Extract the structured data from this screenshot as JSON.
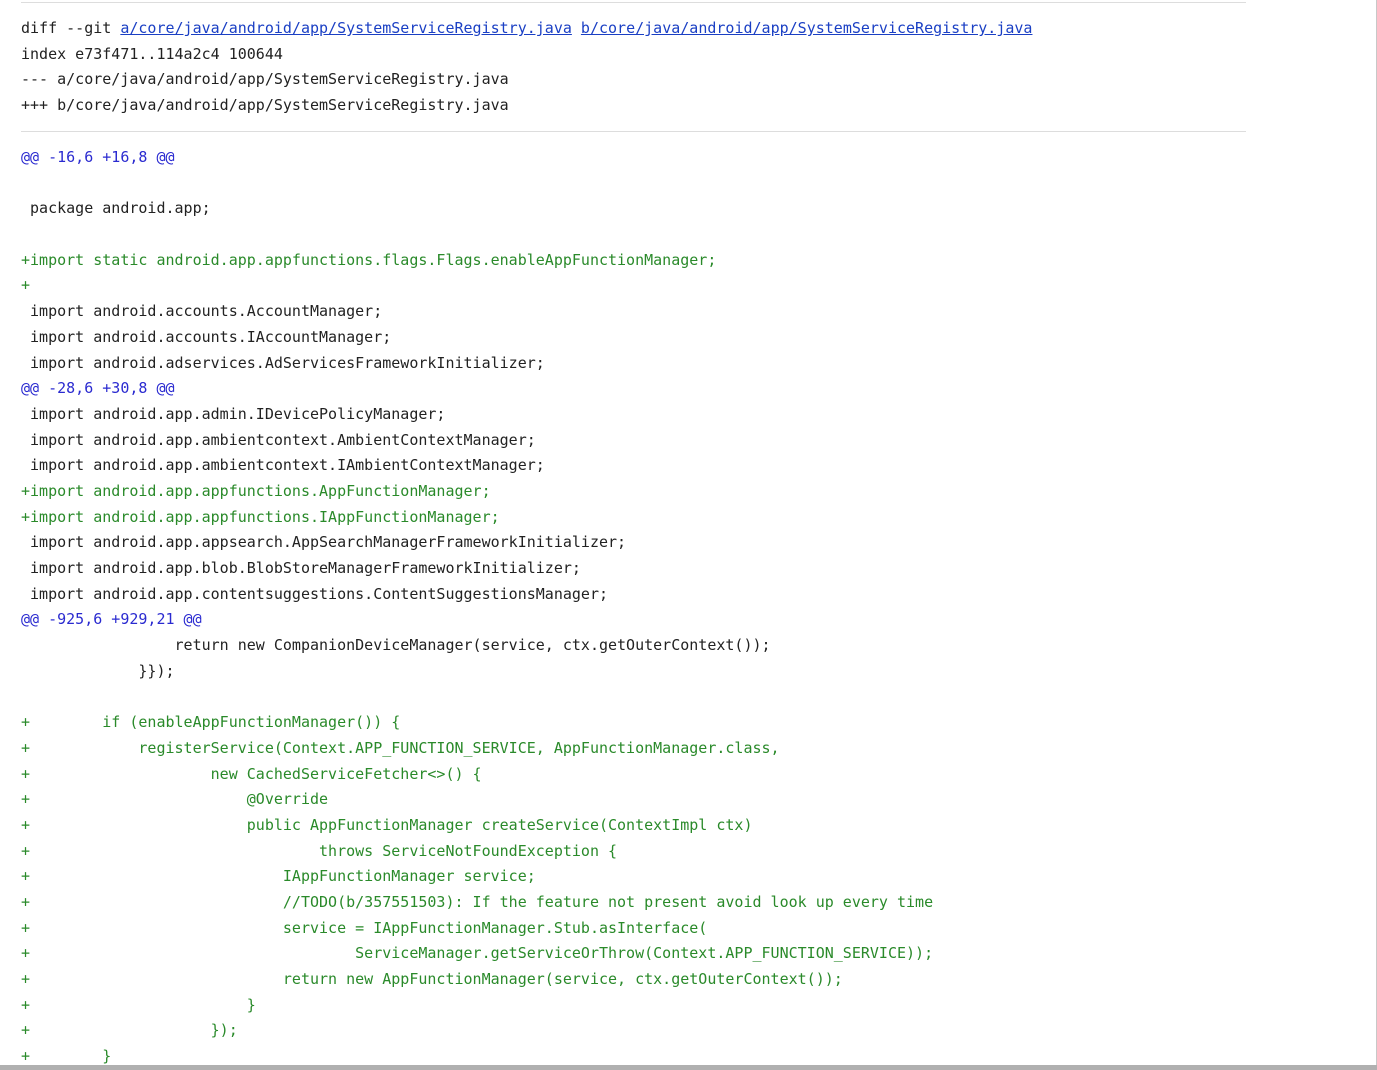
{
  "header": {
    "diff_cmd": "diff --git ",
    "path_a_link": "a/core/java/android/app/SystemServiceRegistry.java",
    "path_b_link": "b/core/java/android/app/SystemServiceRegistry.java",
    "index_line": "index e73f471..114a2c4 100644",
    "minus_line": "--- a/core/java/android/app/SystemServiceRegistry.java",
    "plus_line": "+++ b/core/java/android/app/SystemServiceRegistry.java"
  },
  "lines": [
    {
      "type": "hunk",
      "text": "@@ -16,6 +16,8 @@"
    },
    {
      "type": "blank",
      "text": " "
    },
    {
      "type": "context",
      "text": " package android.app;"
    },
    {
      "type": "blank",
      "text": " "
    },
    {
      "type": "add",
      "text": "+import static android.app.appfunctions.flags.Flags.enableAppFunctionManager;"
    },
    {
      "type": "add",
      "text": "+"
    },
    {
      "type": "context",
      "text": " import android.accounts.AccountManager;"
    },
    {
      "type": "context",
      "text": " import android.accounts.IAccountManager;"
    },
    {
      "type": "context",
      "text": " import android.adservices.AdServicesFrameworkInitializer;"
    },
    {
      "type": "hunk",
      "text": "@@ -28,6 +30,8 @@"
    },
    {
      "type": "context",
      "text": " import android.app.admin.IDevicePolicyManager;"
    },
    {
      "type": "context",
      "text": " import android.app.ambientcontext.AmbientContextManager;"
    },
    {
      "type": "context",
      "text": " import android.app.ambientcontext.IAmbientContextManager;"
    },
    {
      "type": "add",
      "text": "+import android.app.appfunctions.AppFunctionManager;"
    },
    {
      "type": "add",
      "text": "+import android.app.appfunctions.IAppFunctionManager;"
    },
    {
      "type": "context",
      "text": " import android.app.appsearch.AppSearchManagerFrameworkInitializer;"
    },
    {
      "type": "context",
      "text": " import android.app.blob.BlobStoreManagerFrameworkInitializer;"
    },
    {
      "type": "context",
      "text": " import android.app.contentsuggestions.ContentSuggestionsManager;"
    },
    {
      "type": "hunk",
      "text": "@@ -925,6 +929,21 @@"
    },
    {
      "type": "context",
      "text": "                 return new CompanionDeviceManager(service, ctx.getOuterContext());"
    },
    {
      "type": "context",
      "text": "             }});"
    },
    {
      "type": "blank",
      "text": " "
    },
    {
      "type": "add",
      "text": "+        if (enableAppFunctionManager()) {"
    },
    {
      "type": "add",
      "text": "+            registerService(Context.APP_FUNCTION_SERVICE, AppFunctionManager.class,"
    },
    {
      "type": "add",
      "text": "+                    new CachedServiceFetcher<>() {"
    },
    {
      "type": "add",
      "text": "+                        @Override"
    },
    {
      "type": "add",
      "text": "+                        public AppFunctionManager createService(ContextImpl ctx)"
    },
    {
      "type": "add",
      "text": "+                                throws ServiceNotFoundException {"
    },
    {
      "type": "add",
      "text": "+                            IAppFunctionManager service;"
    },
    {
      "type": "add",
      "text": "+                            //TODO(b/357551503): If the feature not present avoid look up every time"
    },
    {
      "type": "add",
      "text": "+                            service = IAppFunctionManager.Stub.asInterface("
    },
    {
      "type": "add",
      "text": "+                                    ServiceManager.getServiceOrThrow(Context.APP_FUNCTION_SERVICE));"
    },
    {
      "type": "add",
      "text": "+                            return new AppFunctionManager(service, ctx.getOuterContext());"
    },
    {
      "type": "add",
      "text": "+                        }"
    },
    {
      "type": "add",
      "text": "+                    });"
    },
    {
      "type": "add",
      "text": "+        }"
    }
  ]
}
